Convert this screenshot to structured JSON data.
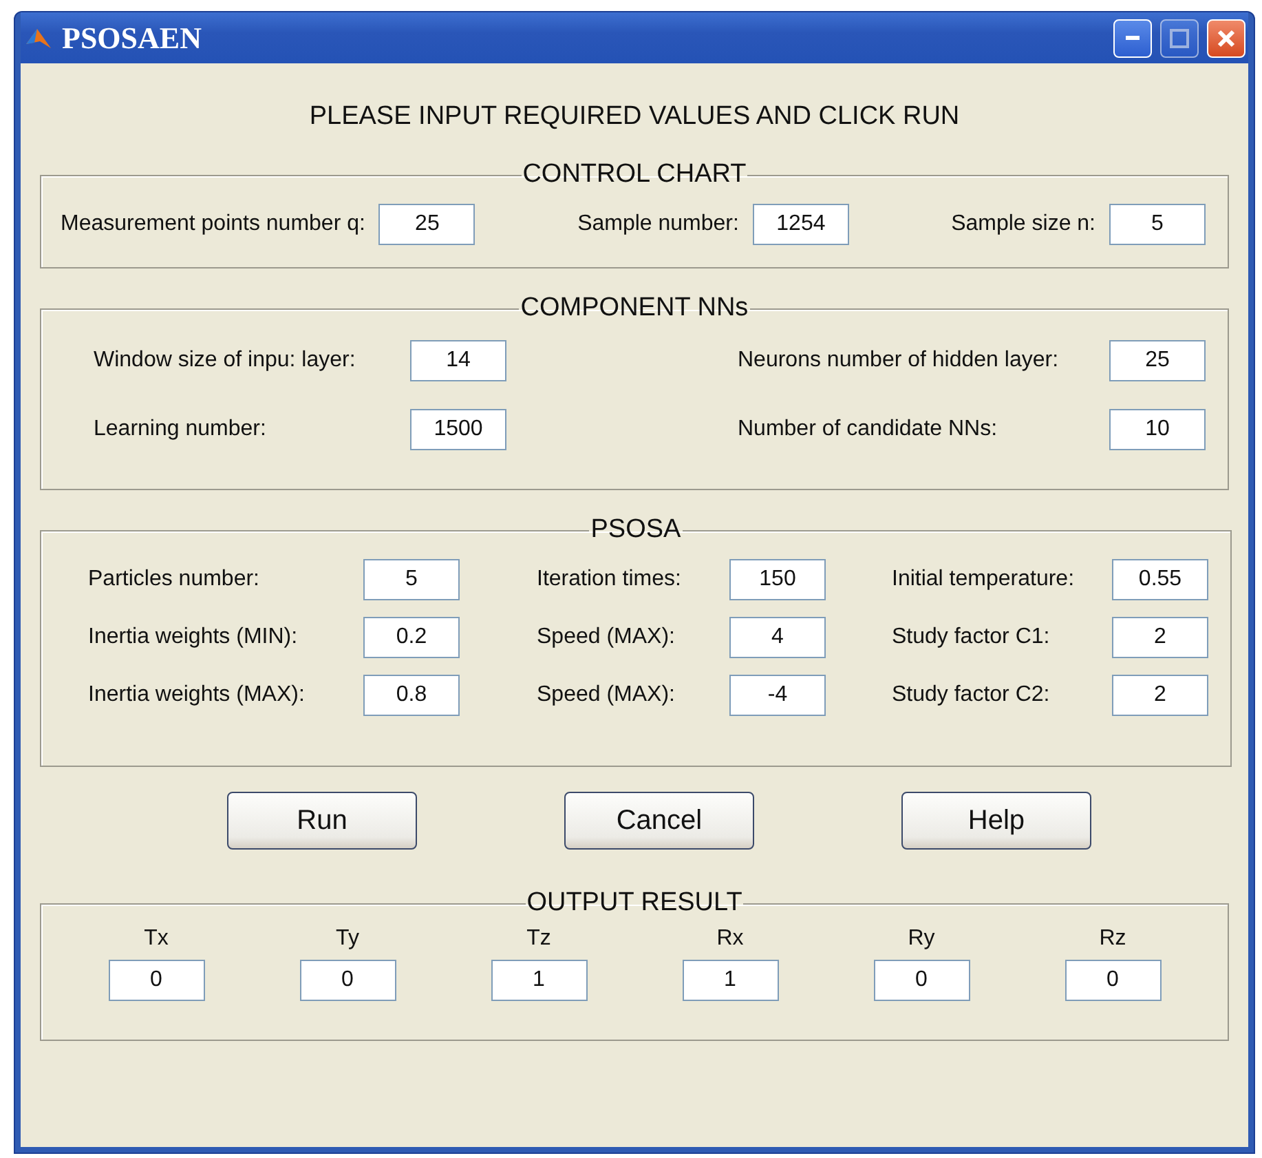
{
  "window": {
    "title": "PSOSAEN"
  },
  "instruction": "PLEASE INPUT REQUIRED VALUES AND CLICK RUN",
  "control_chart": {
    "title": "CONTROL CHART",
    "fields": [
      {
        "label": "Measurement points number q:",
        "value": "25"
      },
      {
        "label": "Sample number:",
        "value": "1254"
      },
      {
        "label": "Sample size n:",
        "value": "5"
      }
    ]
  },
  "component_nns": {
    "title": "COMPONENT NNs",
    "fields": [
      {
        "label": "Window size of inpu: layer:",
        "value": "14"
      },
      {
        "label": "Neurons number of hidden layer:",
        "value": "25"
      },
      {
        "label": "Learning number:",
        "value": "1500"
      },
      {
        "label": "Number of candidate NNs:",
        "value": "10"
      }
    ]
  },
  "psosa": {
    "title": "PSOSA",
    "fields": [
      {
        "label": "Particles number:",
        "value": "5"
      },
      {
        "label": "Iteration times:",
        "value": "150"
      },
      {
        "label": "Initial temperature:",
        "value": "0.55"
      },
      {
        "label": "Inertia weights (MIN):",
        "value": "0.2"
      },
      {
        "label": "Speed (MAX):",
        "value": "4"
      },
      {
        "label": "Study factor C1:",
        "value": "2"
      },
      {
        "label": "Inertia weights (MAX):",
        "value": "0.8"
      },
      {
        "label": "Speed (MAX):",
        "value": "-4"
      },
      {
        "label": "Study factor C2:",
        "value": "2"
      }
    ]
  },
  "buttons": [
    "Run",
    "Cancel",
    "Help"
  ],
  "output_result": {
    "title": "OUTPUT RESULT",
    "fields": [
      {
        "label": "Tx",
        "value": "0"
      },
      {
        "label": "Ty",
        "value": "0"
      },
      {
        "label": "Tz",
        "value": "1"
      },
      {
        "label": "Rx",
        "value": "1"
      },
      {
        "label": "Ry",
        "value": "0"
      },
      {
        "label": "Rz",
        "value": "0"
      }
    ]
  }
}
